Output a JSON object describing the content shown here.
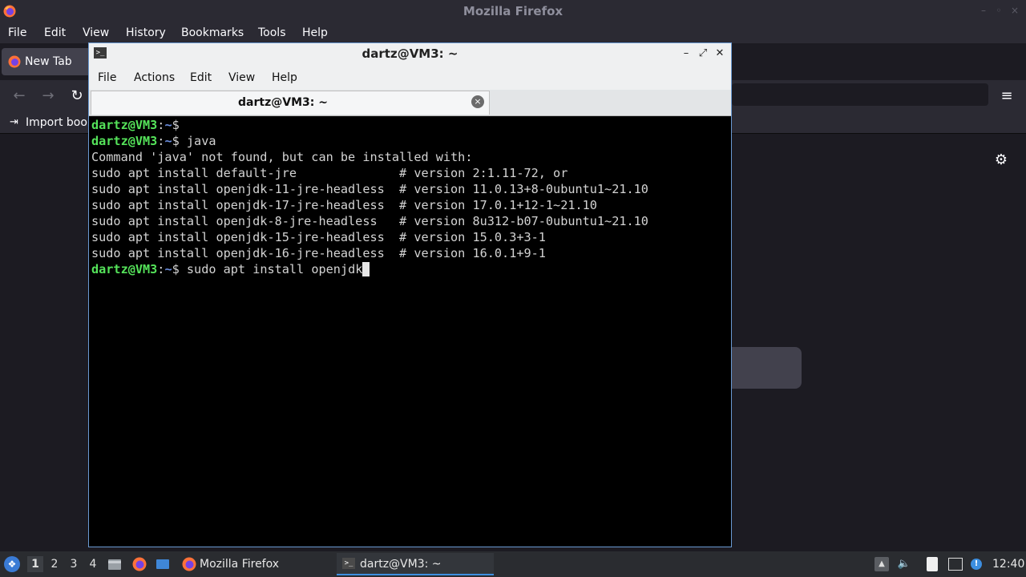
{
  "firefox": {
    "window_title": "Mozilla Firefox",
    "menu": [
      "File",
      "Edit",
      "View",
      "History",
      "Bookmarks",
      "Tools",
      "Help"
    ],
    "tab_label": "New Tab",
    "bookmarks_import_label": "Import book",
    "win_controls": {
      "minimize": "–",
      "restore": "◦",
      "close": "×"
    },
    "icons": {
      "back": "←",
      "forward": "→",
      "reload": "↻",
      "menu": "≡",
      "import": "⇥",
      "gear": "⚙"
    }
  },
  "terminal": {
    "title": "dartz@VM3: ~",
    "menu": [
      "File",
      "Actions",
      "Edit",
      "View",
      "Help"
    ],
    "tab_label": "dartz@VM3: ~",
    "controls": {
      "minimize": "–",
      "maximize": "⤢",
      "close": "✕"
    },
    "prompt_user": "dartz@VM3",
    "prompt_sep": ":",
    "prompt_path": "~",
    "prompt_dollar": "$ ",
    "lines": [
      {
        "prompt": true,
        "text": ""
      },
      {
        "prompt": true,
        "text": "java"
      },
      {
        "prompt": false,
        "text": "Command 'java' not found, but can be installed with:"
      },
      {
        "prompt": false,
        "text": "sudo apt install default-jre              # version 2:1.11-72, or"
      },
      {
        "prompt": false,
        "text": "sudo apt install openjdk-11-jre-headless  # version 11.0.13+8-0ubuntu1~21.10"
      },
      {
        "prompt": false,
        "text": "sudo apt install openjdk-17-jre-headless  # version 17.0.1+12-1~21.10"
      },
      {
        "prompt": false,
        "text": "sudo apt install openjdk-8-jre-headless   # version 8u312-b07-0ubuntu1~21.10"
      },
      {
        "prompt": false,
        "text": "sudo apt install openjdk-15-jre-headless  # version 15.0.3+3-1"
      },
      {
        "prompt": false,
        "text": "sudo apt install openjdk-16-jre-headless  # version 16.0.1+9-1"
      },
      {
        "prompt": true,
        "text": "sudo apt install openjdk",
        "cursor": true
      }
    ]
  },
  "taskbar": {
    "workspaces": [
      "1",
      "2",
      "3",
      "4"
    ],
    "active_workspace": "1",
    "tasks": [
      {
        "label": "Mozilla Firefox",
        "icon": "firefox-icon"
      },
      {
        "label": "dartz@VM3: ~",
        "icon": "terminal-icon",
        "active": true
      }
    ],
    "clock": "12:40",
    "tray_icons": {
      "updates": "▲",
      "volume": "🔈",
      "clipboard": "▯",
      "network": "▭",
      "notification": "!"
    }
  },
  "colors": {
    "prompt_user": "#55e35a",
    "prompt_path": "#6c8fe0",
    "accent": "#3d8fe0"
  }
}
